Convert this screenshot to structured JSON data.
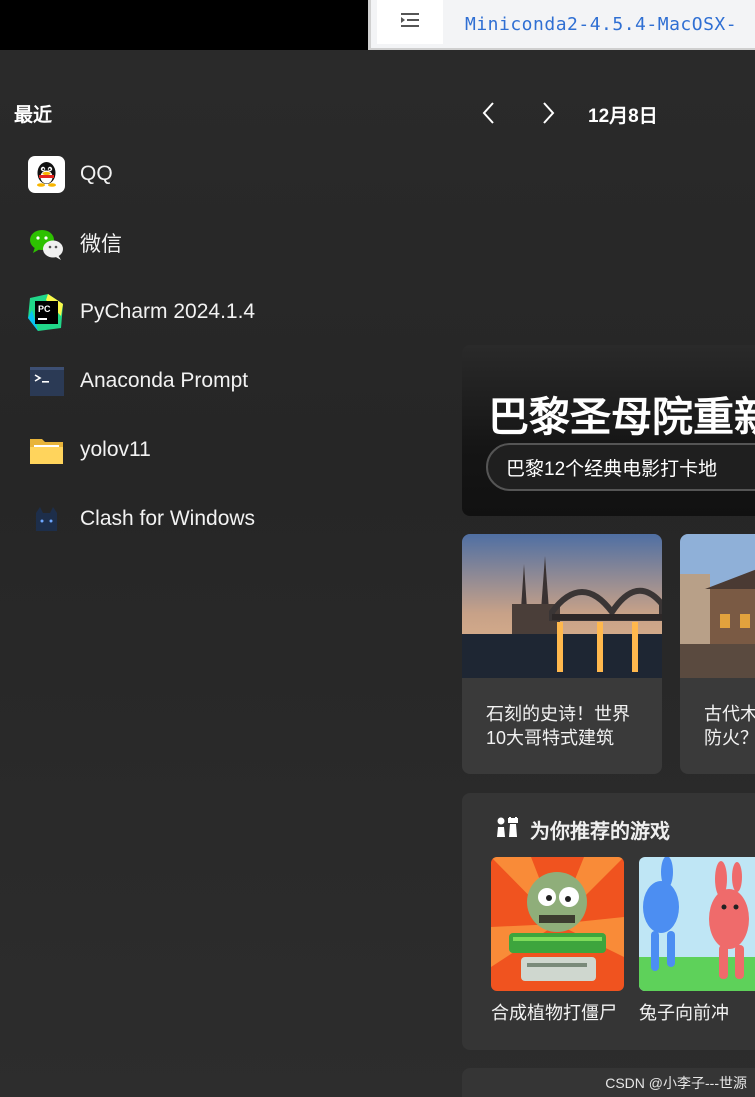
{
  "browser": {
    "url_text": "Miniconda2-4.5.4-MacOSX-"
  },
  "recent": {
    "title": "最近",
    "items": [
      {
        "label": "QQ",
        "icon": "qq-icon"
      },
      {
        "label": "微信",
        "icon": "wechat-icon"
      },
      {
        "label": "PyCharm 2024.1.4",
        "icon": "pycharm-icon"
      },
      {
        "label": "Anaconda Prompt",
        "icon": "terminal-icon"
      },
      {
        "label": "yolov11",
        "icon": "folder-icon"
      },
      {
        "label": "Clash for Windows",
        "icon": "clash-cat-icon"
      }
    ]
  },
  "feed": {
    "date": "12月8日",
    "hero_title": "巴黎圣母院重新",
    "hero_chip": "巴黎12个经典电影打卡地",
    "cards": [
      {
        "caption": "石刻的史诗！世界10大哥特式建筑"
      },
      {
        "caption": "古代木防火？"
      }
    ],
    "games_title": "为你推荐的游戏",
    "games": [
      {
        "name": "合成植物打僵尸"
      },
      {
        "name": "兔子向前冲"
      }
    ]
  },
  "watermark": "CSDN @小李子---世源",
  "colors": {
    "panel_bg": "#262626",
    "card_bg": "#3a3a3a",
    "url_blue": "#2f6fd3"
  }
}
